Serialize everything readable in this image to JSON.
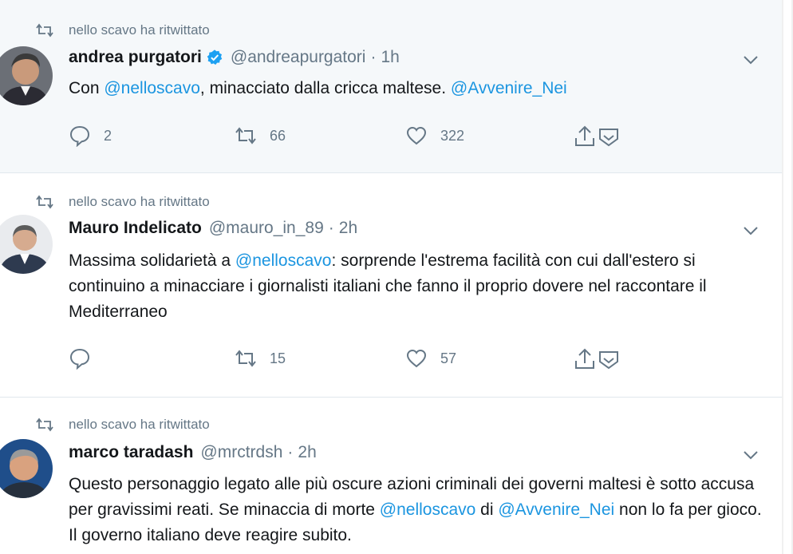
{
  "tweets": [
    {
      "retweeted_by": "nello scavo ha ritwittato",
      "name": "andrea purgatori",
      "verified": true,
      "handle": "@andreapurgatori",
      "time": "1h",
      "text": [
        {
          "t": "Con ",
          "m": false
        },
        {
          "t": "@nelloscavo",
          "m": true
        },
        {
          "t": ", minacciato dalla cricca maltese. ",
          "m": false
        },
        {
          "t": "@Avvenire_Nei",
          "m": true
        }
      ],
      "replies": "2",
      "retweets": "66",
      "likes": "322",
      "highlighted": true
    },
    {
      "retweeted_by": "nello scavo ha ritwittato",
      "name": "Mauro Indelicato",
      "verified": false,
      "handle": "@mauro_in_89",
      "time": "2h",
      "text": [
        {
          "t": "Massima solidarietà a ",
          "m": false
        },
        {
          "t": "@nelloscavo",
          "m": true
        },
        {
          "t": ": sorprende l'estrema facilità con cui dall'estero si continuino a minacciare i giornalisti italiani che fanno il proprio dovere nel raccontare il Mediterraneo",
          "m": false
        }
      ],
      "replies": "",
      "retweets": "15",
      "likes": "57",
      "highlighted": false
    },
    {
      "retweeted_by": "nello scavo ha ritwittato",
      "name": "marco taradash",
      "verified": false,
      "handle": "@mrctrdsh",
      "time": "2h",
      "text": [
        {
          "t": "Questo personaggio legato alle più oscure azioni criminali dei governi maltesi è sotto accusa per gravissimi reati. Se minaccia di morte ",
          "m": false
        },
        {
          "t": "@nelloscavo",
          "m": true
        },
        {
          "t": " di ",
          "m": false
        },
        {
          "t": "@Avvenire_Nei",
          "m": true
        },
        {
          "t": " non lo fa per gioco. Il governo italiano deve reagire subito.",
          "m": false
        }
      ],
      "replies": "",
      "retweets": "",
      "likes": "",
      "highlighted": false
    }
  ],
  "separator": "·",
  "colors": {
    "accent": "#1b95e0",
    "muted": "#657786",
    "text": "#14171a",
    "highlight_bg": "#f5f8fa"
  },
  "icons": {
    "retweet_context": "retweet-icon",
    "verified": "verified-badge-icon",
    "caret": "chevron-down-icon",
    "reply": "reply-icon",
    "retweet": "retweet-icon",
    "like": "heart-icon",
    "share": "share-icon",
    "dm": "direct-message-icon"
  }
}
